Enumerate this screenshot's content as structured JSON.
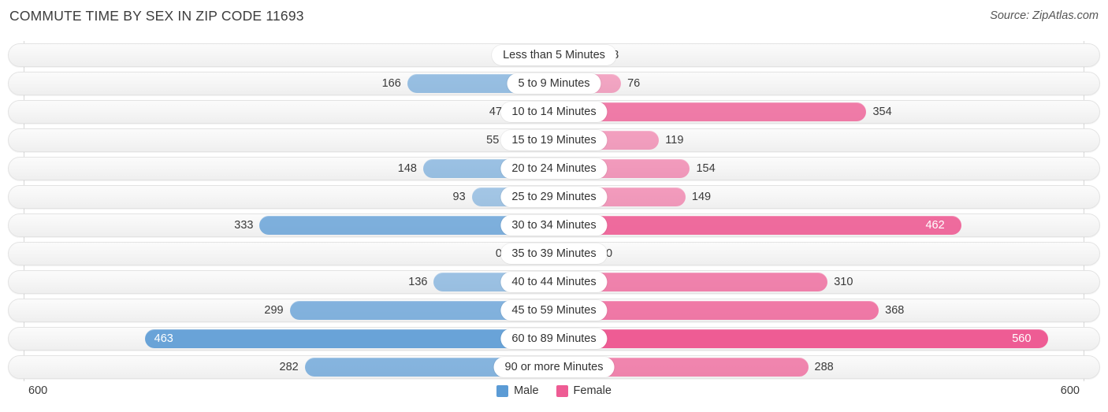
{
  "header": {
    "title": "COMMUTE TIME BY SEX IN ZIP CODE 11693",
    "source": "Source: ZipAtlas.com"
  },
  "axis": {
    "left_label": "600",
    "right_label": "600"
  },
  "legend": {
    "male_label": "Male",
    "female_label": "Female",
    "male_color": "#5b9bd5",
    "female_color": "#ee5c94"
  },
  "chart_data": {
    "type": "bar",
    "subtype": "diverging-bidirectional",
    "title": "COMMUTE TIME BY SEX IN ZIP CODE 11693",
    "xlabel": "",
    "ylabel": "",
    "xlim": [
      600,
      600
    ],
    "axis_max": 600,
    "grid": true,
    "legend_position": "bottom-center",
    "series": [
      {
        "name": "Male",
        "color": "#5b9bd5",
        "direction": "left",
        "values": [
          0,
          166,
          47,
          55,
          148,
          93,
          333,
          0,
          136,
          299,
          463,
          282
        ]
      },
      {
        "name": "Female",
        "color": "#ee5c94",
        "direction": "right",
        "values": [
          18,
          76,
          354,
          119,
          154,
          149,
          462,
          0,
          310,
          368,
          560,
          288
        ]
      }
    ],
    "categories": [
      "Less than 5 Minutes",
      "5 to 9 Minutes",
      "10 to 14 Minutes",
      "15 to 19 Minutes",
      "20 to 24 Minutes",
      "25 to 29 Minutes",
      "30 to 34 Minutes",
      "35 to 39 Minutes",
      "40 to 44 Minutes",
      "45 to 59 Minutes",
      "60 to 89 Minutes",
      "90 or more Minutes"
    ],
    "rows": [
      {
        "label": "Less than 5 Minutes",
        "male": 0,
        "female": 18
      },
      {
        "label": "5 to 9 Minutes",
        "male": 166,
        "female": 76
      },
      {
        "label": "10 to 14 Minutes",
        "male": 47,
        "female": 354
      },
      {
        "label": "15 to 19 Minutes",
        "male": 55,
        "female": 119
      },
      {
        "label": "20 to 24 Minutes",
        "male": 148,
        "female": 154
      },
      {
        "label": "25 to 29 Minutes",
        "male": 93,
        "female": 149
      },
      {
        "label": "30 to 34 Minutes",
        "male": 333,
        "female": 462
      },
      {
        "label": "35 to 39 Minutes",
        "male": 0,
        "female": 0
      },
      {
        "label": "40 to 44 Minutes",
        "male": 136,
        "female": 310
      },
      {
        "label": "45 to 59 Minutes",
        "male": 299,
        "female": 368
      },
      {
        "label": "60 to 89 Minutes",
        "male": 463,
        "female": 560
      },
      {
        "label": "90 or more Minutes",
        "male": 282,
        "female": 288
      }
    ]
  }
}
